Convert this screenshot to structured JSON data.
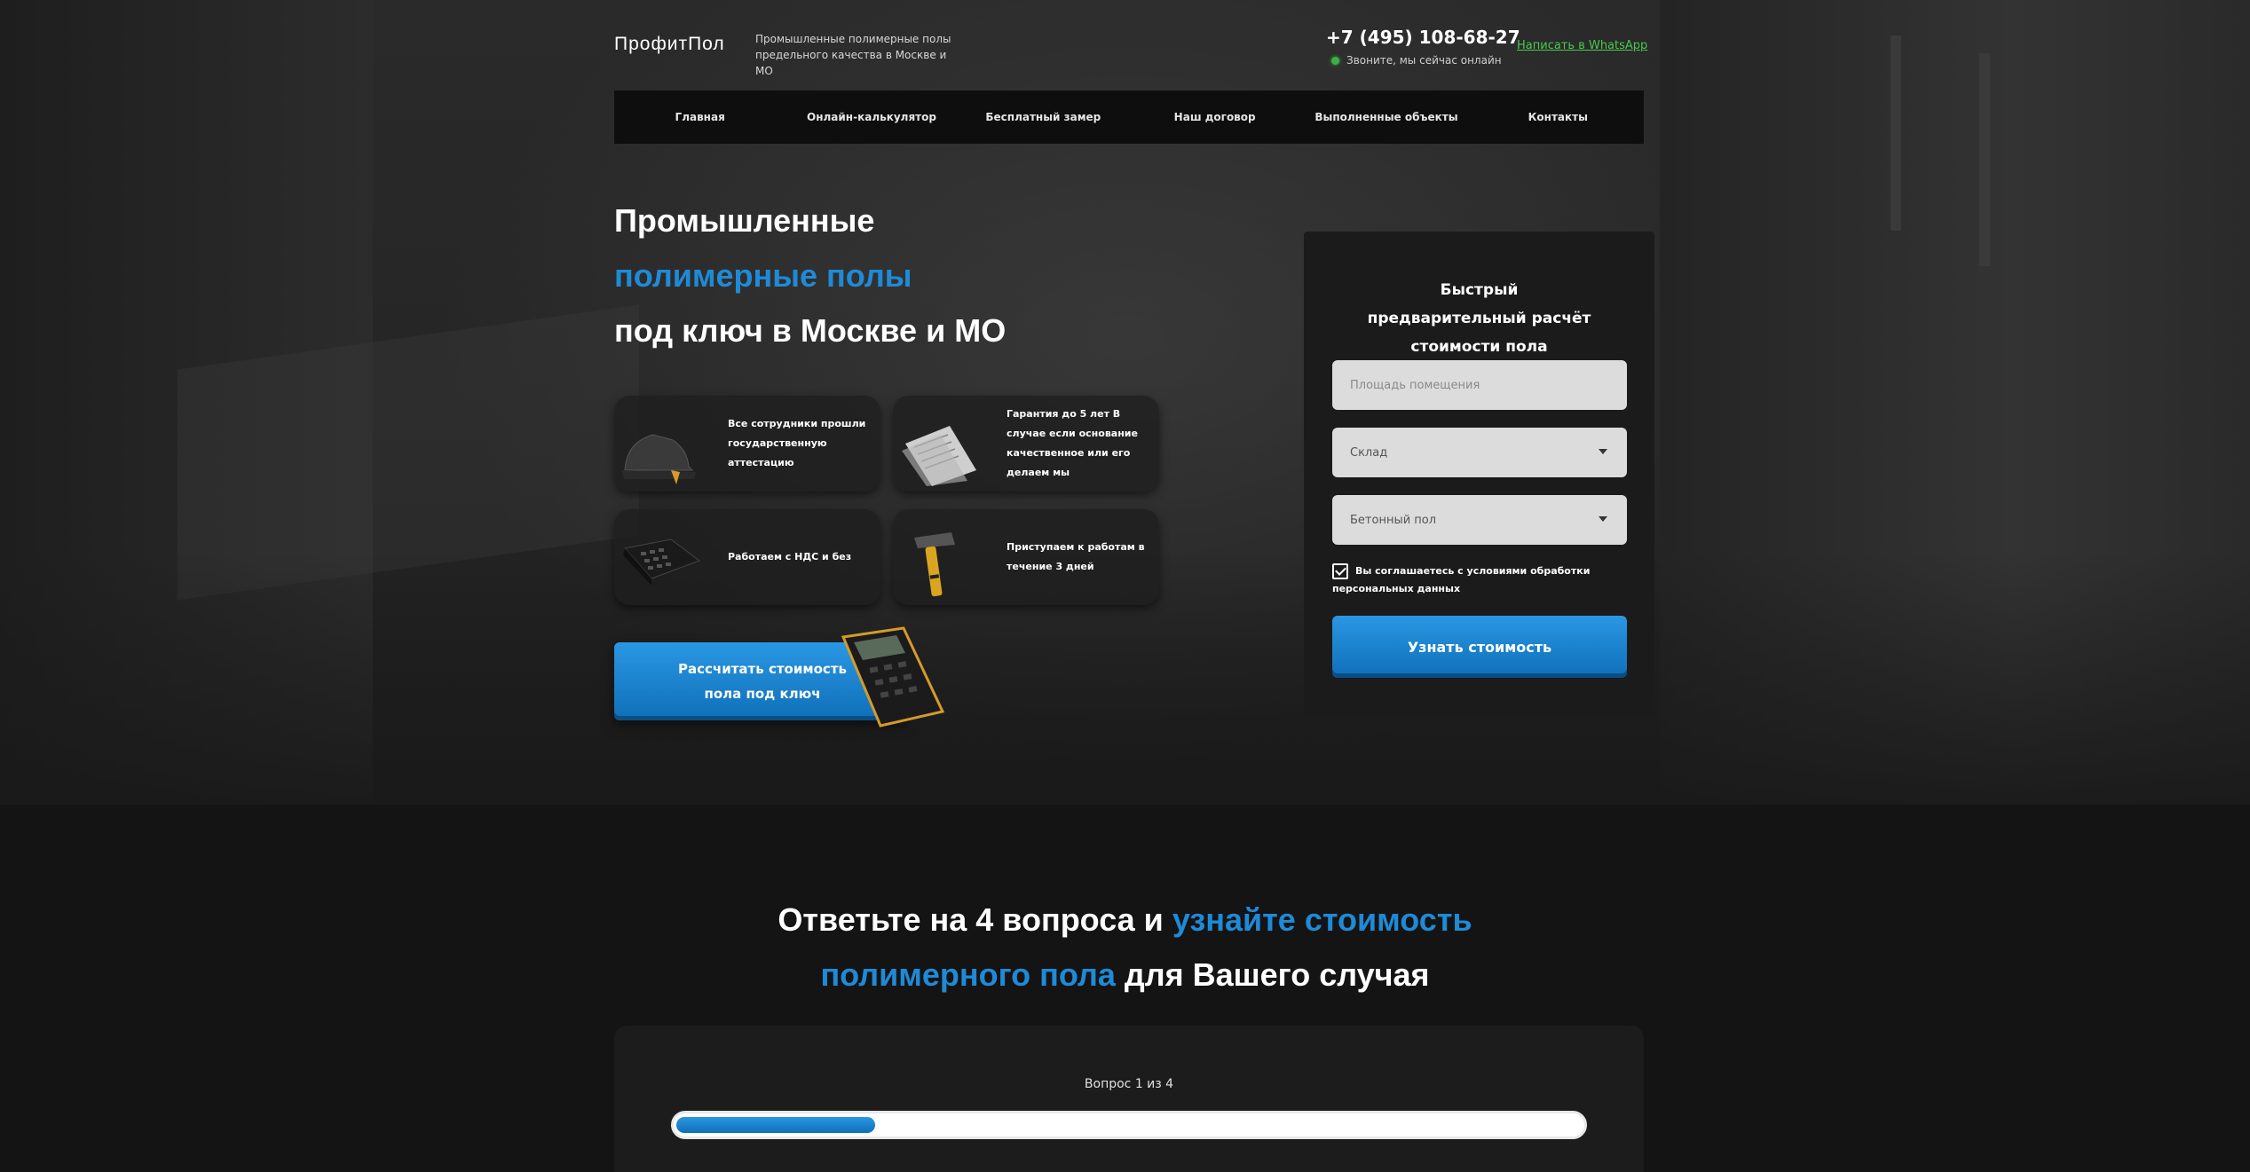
{
  "header": {
    "logo": "ПрофитПол",
    "tagline": "Промышленные полимерные полы предельного качества в Москве и МО",
    "phone": "+7 (495) 108-68-27",
    "online_status": "Звоните, мы сейчас онлайн",
    "whatsapp": "Написать в WhatsApp"
  },
  "nav": [
    {
      "label": "Главная"
    },
    {
      "label": "Онлайн-калькулятор"
    },
    {
      "label": "Бесплатный замер"
    },
    {
      "label": "Наш договор"
    },
    {
      "label": "Выполненные объекты"
    },
    {
      "label": "Контакты"
    }
  ],
  "hero": {
    "title_line1": "Промышленные",
    "title_line2": "полимерные полы",
    "title_line3": "под ключ в Москве и МО",
    "features": [
      {
        "text": "Все сотрудники прошли государственную аттестацию",
        "icon": "hardhat-icon"
      },
      {
        "text": "Гарантия до 5 лет В случае если основание качественное или его делаем мы",
        "icon": "document-icon"
      },
      {
        "text": "Работаем с НДС и без",
        "icon": "calculator-icon"
      },
      {
        "text": "Приступаем к работам в течение 3 дней",
        "icon": "hammer-icon"
      }
    ],
    "cta": "Рассчитать стоимость пола под ключ"
  },
  "form": {
    "title": "Быстрый предварительный расчёт стоимости пола",
    "area_placeholder": "Площадь помещения",
    "object_type": "Склад",
    "base_type": "Бетонный пол",
    "consent": "Вы соглашаетесь с условиями обработки персональных данных",
    "submit": "Узнать стоимость"
  },
  "quiz": {
    "title_part1": "Ответьте на 4 вопроса и ",
    "title_part2": "узнайте стоимость",
    "title_part3": "полимерного пола",
    "title_part4": " для Вашего случая",
    "step": "Вопрос 1 из 4",
    "progress": 0.22
  },
  "colors": {
    "accent": "#1f8ad6",
    "whatsapp": "#49c94f",
    "online": "#3cb043"
  }
}
